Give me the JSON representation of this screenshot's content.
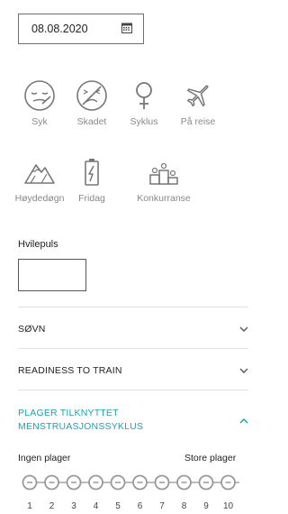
{
  "date": {
    "value": "08.08.2020",
    "icon": "calendar-icon"
  },
  "tags": [
    {
      "label": "Syk",
      "icon": "sick-face-icon"
    },
    {
      "label": "Skadet",
      "icon": "injured-face-icon"
    },
    {
      "label": "Syklus",
      "icon": "female-symbol-icon"
    },
    {
      "label": "På reise",
      "icon": "airplane-icon"
    },
    {
      "label": "Høydedøgn",
      "icon": "mountain-icon"
    },
    {
      "label": "Fridag",
      "icon": "battery-icon"
    },
    {
      "label": "Konkurranse",
      "icon": "podium-icon"
    }
  ],
  "hvilepuls": {
    "label": "Hvilepuls",
    "value": ""
  },
  "sections": [
    {
      "title": "SØVN",
      "expanded": false
    },
    {
      "title": "READINESS TO TRAIN",
      "expanded": false
    },
    {
      "title_line1": "PLAGER TILKNYTTET",
      "title_line2": "MENSTRUASJONSSYKLUS",
      "expanded": true
    }
  ],
  "scale": {
    "min_label": "Ingen plager",
    "max_label": "Store plager",
    "numbers": [
      "1",
      "2",
      "3",
      "4",
      "5",
      "6",
      "7",
      "8",
      "9",
      "10"
    ]
  },
  "colors": {
    "accent": "#1ba3b3",
    "text": "#222222",
    "muted": "#888888"
  }
}
